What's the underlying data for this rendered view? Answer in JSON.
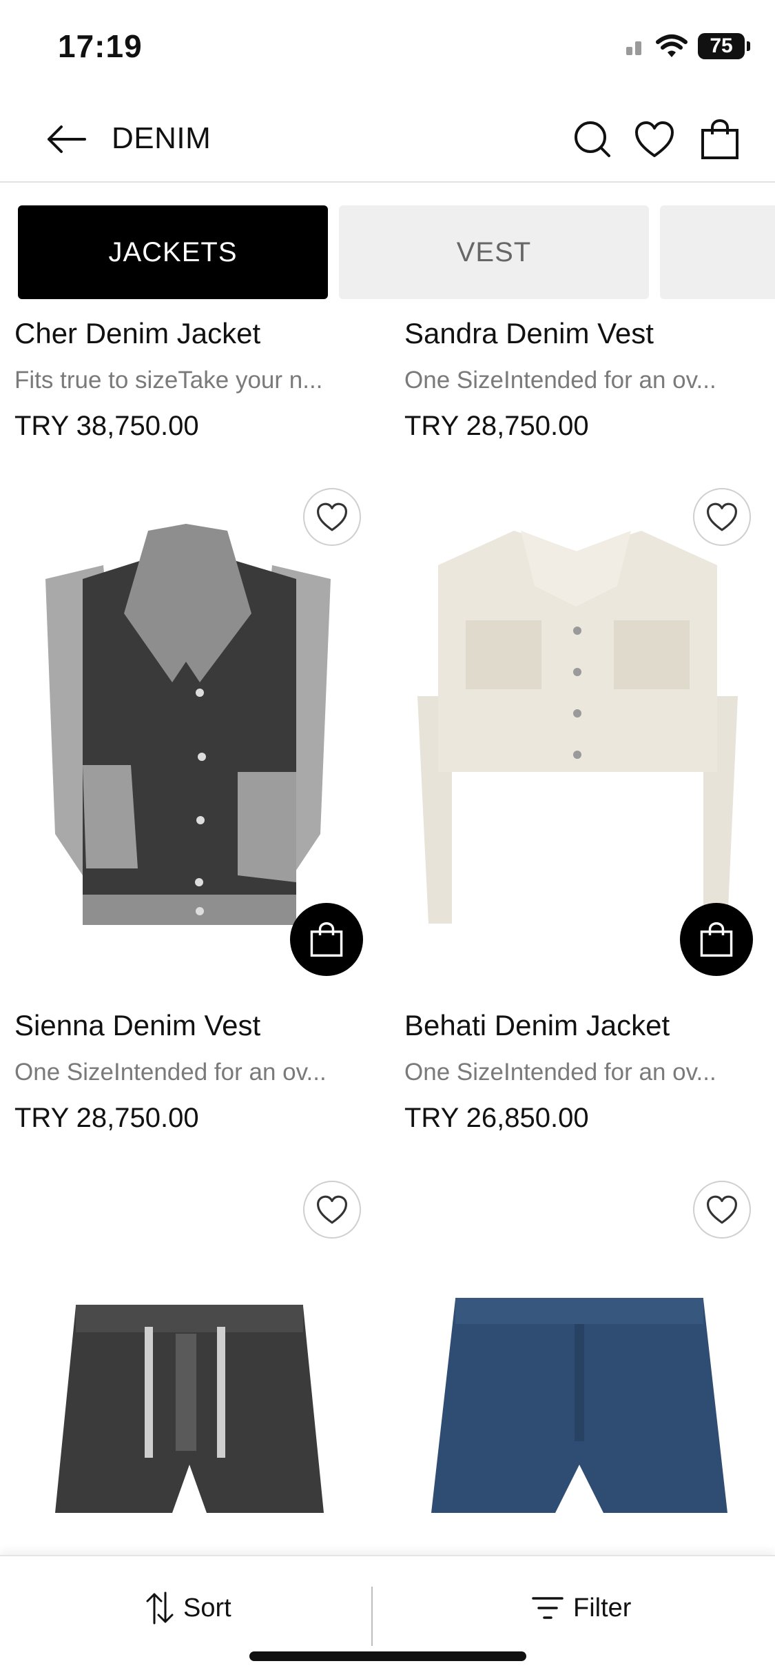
{
  "status_bar": {
    "time": "17:19",
    "battery": "75"
  },
  "nav": {
    "title": "DENIM"
  },
  "tabs": [
    {
      "label": "JACKETS",
      "active": true
    },
    {
      "label": "VEST",
      "active": false
    },
    {
      "label": "",
      "active": false
    }
  ],
  "products": [
    {
      "name": "Cher Denim Jacket",
      "desc": "Fits true to sizeTake your n...",
      "price": "TRY 38,750.00"
    },
    {
      "name": "Sandra Denim Vest",
      "desc": "One SizeIntended for an ov...",
      "price": "TRY 28,750.00"
    },
    {
      "name": "Sienna Denim Vest",
      "desc": "One SizeIntended for an ov...",
      "price": "TRY 28,750.00"
    },
    {
      "name": "Behati Denim Jacket",
      "desc": "One SizeIntended for an ov...",
      "price": "TRY 26,850.00"
    }
  ],
  "bottom_bar": {
    "sort_label": "Sort",
    "filter_label": "Filter"
  },
  "icons": {
    "back": "arrow-left-icon",
    "search": "search-icon",
    "wishlist": "heart-icon",
    "bag": "shopping-bag-icon",
    "sort": "sort-arrows-icon",
    "filter": "filter-lines-icon"
  },
  "colors": {
    "accent": "#000000",
    "tab_inactive_bg": "#efefef",
    "muted_text": "#7a7a7a"
  }
}
